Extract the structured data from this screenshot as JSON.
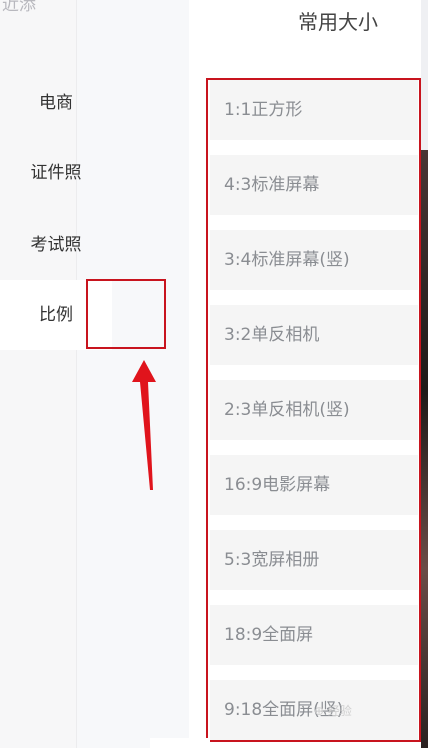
{
  "left_panel": {
    "partial_label": "近添"
  },
  "header": {
    "title": "常用大小"
  },
  "nav": {
    "items": [
      {
        "label": "电商"
      },
      {
        "label": "证件照"
      },
      {
        "label": "考试照"
      },
      {
        "label": "比例"
      }
    ]
  },
  "options": [
    {
      "label": "1:1正方形"
    },
    {
      "label": "4:3标准屏幕"
    },
    {
      "label": "3:4标准屏幕(竖)"
    },
    {
      "label": "3:2单反相机"
    },
    {
      "label": "2:3单反相机(竖)"
    },
    {
      "label": "16:9电影屏幕"
    },
    {
      "label": "5:3宽屏相册"
    },
    {
      "label": "18:9全面屏"
    },
    {
      "label": "9:18全面屏(竖)"
    }
  ],
  "watermark": {
    "text": "⊕ 经验"
  },
  "colors": {
    "highlight_box": "#c8141e",
    "arrow": "#e0141c"
  }
}
